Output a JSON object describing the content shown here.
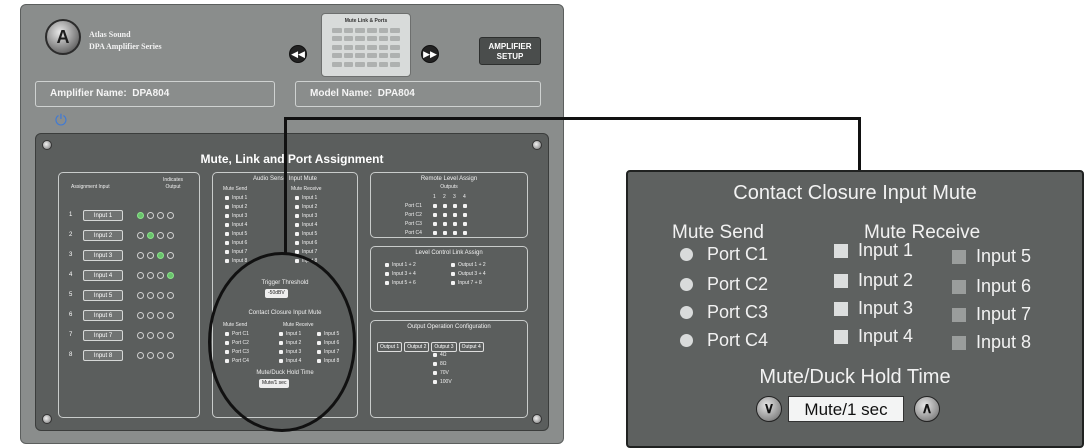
{
  "header": {
    "brand_line1": "Atlas Sound",
    "brand_line2": "DPA Amplifier Series",
    "prev_icon": "chevron-left-icon",
    "next_icon": "chevron-right-icon",
    "matrix_title": "Mute Link & Ports",
    "amp_setup_line1": "AMPLIFIER",
    "amp_setup_line2": "SETUP"
  },
  "names": {
    "amplifier_label": "Amplifier Name:",
    "amplifier_value": "DPA804",
    "model_label": "Model Name:",
    "model_value": "DPA804"
  },
  "assignment": {
    "title": "Mute, Link and Port Assignment",
    "col_input": "Assignment Input",
    "col_output": "Indicates Output",
    "rows": [
      {
        "num": "1",
        "label": "Input 1",
        "leds": [
          1,
          0,
          0,
          0
        ]
      },
      {
        "num": "2",
        "label": "Input 2",
        "leds": [
          0,
          1,
          0,
          0
        ]
      },
      {
        "num": "3",
        "label": "Input 3",
        "leds": [
          0,
          0,
          1,
          0
        ]
      },
      {
        "num": "4",
        "label": "Input 4",
        "leds": [
          0,
          0,
          0,
          1
        ]
      },
      {
        "num": "5",
        "label": "Input 5",
        "leds": [
          0,
          0,
          0,
          0
        ]
      },
      {
        "num": "6",
        "label": "Input 6",
        "leds": [
          0,
          0,
          0,
          0
        ]
      },
      {
        "num": "7",
        "label": "Input 7",
        "leds": [
          0,
          0,
          0,
          0
        ]
      },
      {
        "num": "8",
        "label": "Input 8",
        "leds": [
          0,
          0,
          0,
          0
        ]
      }
    ]
  },
  "audio_sense": {
    "title": "Audio Sense Input Mute",
    "mute_send": "Mute Send",
    "mute_receive": "Mute Receive",
    "send_items": [
      "Input 1",
      "Input 2",
      "Input 3",
      "Input 4",
      "Input 5",
      "Input 6",
      "Input 7",
      "Input 8"
    ],
    "receive_items": [
      "Input 1",
      "Input 2",
      "Input 3",
      "Input 4",
      "Input 5",
      "Input 6",
      "Input 7",
      "Input 8"
    ],
    "trigger_title": "Trigger Threshold",
    "trigger_value": "-50dBV"
  },
  "remote_level": {
    "title": "Remote Level Assign",
    "outputs_label": "Outputs",
    "cols": [
      "1",
      "2",
      "3",
      "4"
    ],
    "rows": [
      "Port C1",
      "Port C2",
      "Port C3",
      "Port C4"
    ]
  },
  "level_link": {
    "title": "Level Control Link Assign",
    "items": [
      "Input 1 + 2",
      "Output 1 + 2",
      "Input 3 + 4",
      "Output 3 + 4",
      "Input 5 + 6",
      "Input 7 + 8"
    ]
  },
  "output_config": {
    "title": "Output Operation Configuration",
    "outputs": [
      "Output 1",
      "Output 2",
      "Output 3",
      "Output 4"
    ],
    "modes": [
      "4Ω",
      "8Ω",
      "70V",
      "100V"
    ]
  },
  "contact_closure": {
    "title": "Contact Closure Input Mute",
    "mute_send": "Mute Send",
    "mute_receive": "Mute Receive",
    "ports": [
      "Port C1",
      "Port C2",
      "Port C3",
      "Port C4"
    ],
    "inputs_left": [
      "Input 1",
      "Input 2",
      "Input 3",
      "Input 4"
    ],
    "inputs_right": [
      "Input 5",
      "Input 6",
      "Input 7",
      "Input 8"
    ],
    "hold_title": "Mute/Duck Hold Time",
    "hold_value": "Mute/1 sec",
    "decrease_icon": "chevron-down-icon",
    "increase_icon": "chevron-up-icon"
  },
  "colors": {
    "panel": "#8a8d8c",
    "inner": "#5b5e5d",
    "led_on": "#69c36b",
    "power": "#3f7ad6"
  }
}
